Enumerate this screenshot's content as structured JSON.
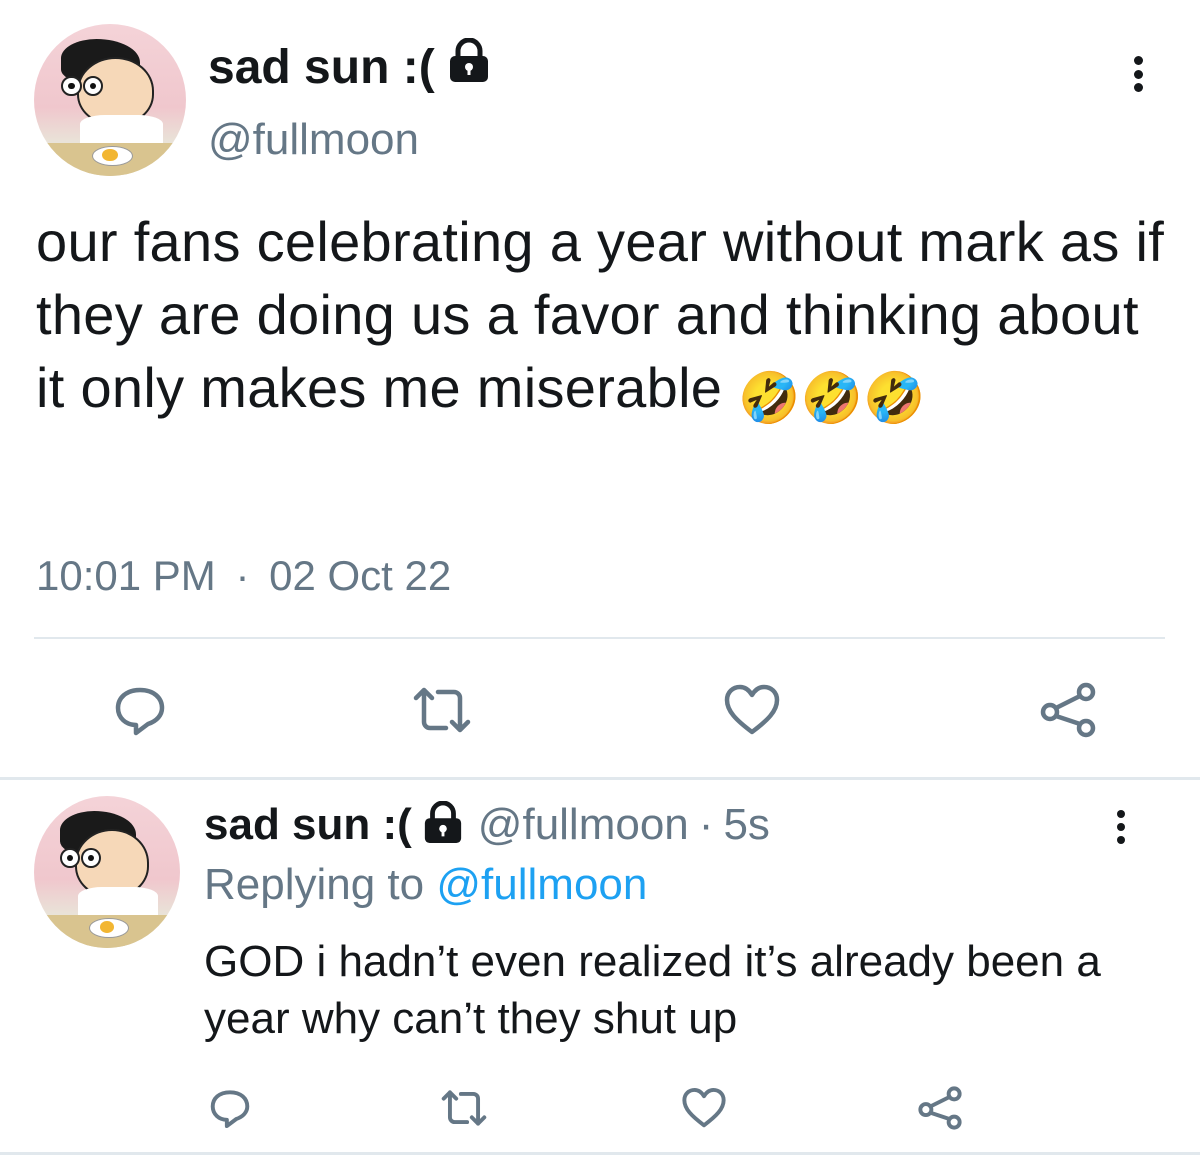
{
  "tweet": {
    "display_name": "sad sun :(",
    "handle": "@fullmoon",
    "text": "our fans celebrating a year without mark as if they are doing us a favor and thinking about it only makes me miserable",
    "emojis": [
      "🤣",
      "🤣",
      "🤣"
    ],
    "time": "10:01 PM",
    "separator": "·",
    "date": "02 Oct 22",
    "icons": [
      "lock-icon",
      "more-icon",
      "reply-icon",
      "retweet-icon",
      "like-icon",
      "share-icon"
    ]
  },
  "reply": {
    "display_name": "sad sun :(",
    "handle": "@fullmoon",
    "separator": "·",
    "age": "5s",
    "replying_label": "Replying to",
    "replying_to": "@fullmoon",
    "text": "GOD i hadn’t even realized it’s already been a year why can’t they shut up"
  },
  "colors": {
    "text": "#14171a",
    "secondary": "#657786",
    "link": "#1da1f2",
    "divider": "#e1e8ed"
  }
}
